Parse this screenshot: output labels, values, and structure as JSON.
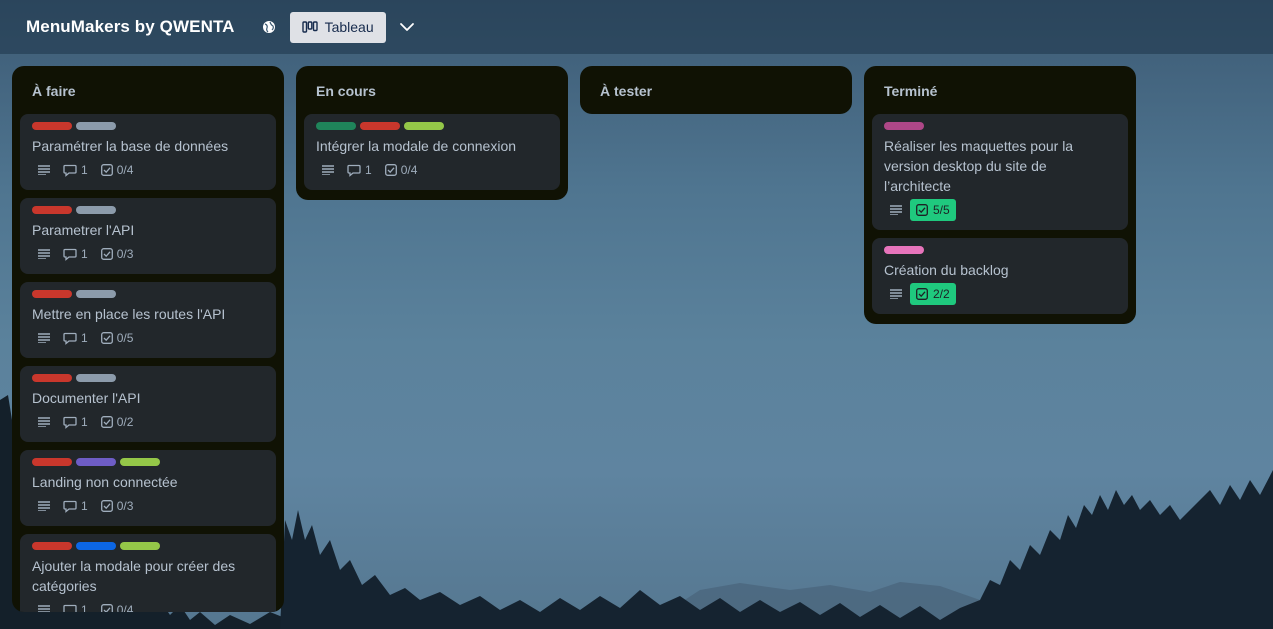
{
  "header": {
    "board_title": "MenuMakers by QWENTA",
    "view_label": "Tableau",
    "visibility_icon": "globe-icon",
    "view_icon": "board-icon",
    "switcher_icon": "chevron-down-icon"
  },
  "colors": {
    "red": "#c9372c",
    "gray": "#8c9bab",
    "green_dark": "#1f845a",
    "lime": "#94c748",
    "purple": "#8f7ee7",
    "blue": "#0c66e4",
    "magenta": "#ae4787",
    "pink": "#e774bb",
    "done_badge": "#1fc97e"
  },
  "lists": [
    {
      "title": "À faire",
      "cards": [
        {
          "title": "Paramétrer la base de données",
          "labels": [
            "red",
            "gray"
          ],
          "comments": "1",
          "checklist": "0/4"
        },
        {
          "title": "Parametrer l'API",
          "labels": [
            "red",
            "gray"
          ],
          "comments": "1",
          "checklist": "0/3"
        },
        {
          "title": "Mettre en place les routes l'API",
          "labels": [
            "red",
            "gray"
          ],
          "comments": "1",
          "checklist": "0/5"
        },
        {
          "title": "Documenter l'API",
          "labels": [
            "red",
            "gray"
          ],
          "comments": "1",
          "checklist": "0/2"
        },
        {
          "title": "Landing non connectée",
          "labels": [
            "red",
            "purple",
            "lime"
          ],
          "comments": "1",
          "checklist": "0/3"
        },
        {
          "title": "Ajouter la modale pour créer des catégories",
          "labels": [
            "red",
            "blue",
            "lime"
          ],
          "comments": "1",
          "checklist": "0/4"
        }
      ]
    },
    {
      "title": "En cours",
      "cards": [
        {
          "title": "Intégrer la modale de connexion",
          "labels": [
            "green_dark",
            "red",
            "lime"
          ],
          "comments": "1",
          "checklist": "0/4"
        }
      ]
    },
    {
      "title": "À tester",
      "cards": []
    },
    {
      "title": "Terminé",
      "cards": [
        {
          "title": "Réaliser les maquettes pour la version desktop du site de l’architecte",
          "labels": [
            "magenta"
          ],
          "checklist": "5/5"
        },
        {
          "title": "Création du backlog",
          "labels": [
            "pink"
          ],
          "checklist": "2/2"
        }
      ]
    }
  ]
}
